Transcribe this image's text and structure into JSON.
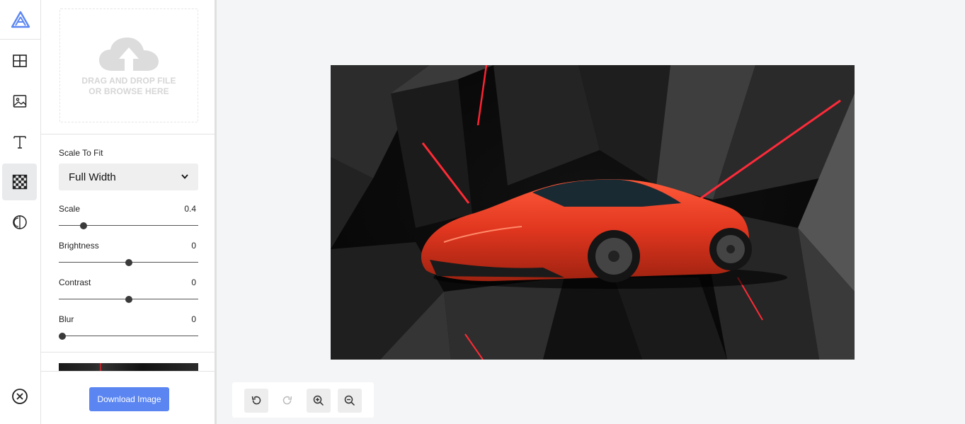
{
  "rail": {
    "items": [
      {
        "icon": "layout-grid-icon"
      },
      {
        "icon": "image-icon"
      },
      {
        "icon": "text-icon"
      },
      {
        "icon": "checkerboard-texture-icon",
        "active": true
      },
      {
        "icon": "contrast-filter-icon"
      }
    ],
    "close_icon": "close-circle-icon",
    "logo_icon": "app-logo-icon"
  },
  "upload": {
    "line1": "DRAG AND DROP FILE",
    "line2": "OR BROWSE HERE",
    "icon": "cloud-upload-icon"
  },
  "settings": {
    "scale_to_fit_label": "Scale To Fit",
    "scale_to_fit_value": "Full Width",
    "scale": {
      "label": "Scale",
      "value": "0.4",
      "fraction": 0.16
    },
    "brightness": {
      "label": "Brightness",
      "value": "0",
      "fraction": 0.5
    },
    "contrast": {
      "label": "Contrast",
      "value": "0",
      "fraction": 0.5
    },
    "blur": {
      "label": "Blur",
      "value": "0",
      "fraction": 0.0
    }
  },
  "footer": {
    "download_label": "Download Image"
  },
  "toolbar": {
    "undo_icon": "undo-icon",
    "redo_icon": "redo-icon",
    "redo_disabled": true,
    "zoom_in_icon": "zoom-in-icon",
    "zoom_out_icon": "zoom-out-icon"
  },
  "colors": {
    "accent": "#5b86f2",
    "logo": "#5b86f2",
    "car": "#e0361f",
    "canvas_bg": "#f4f5f7"
  }
}
